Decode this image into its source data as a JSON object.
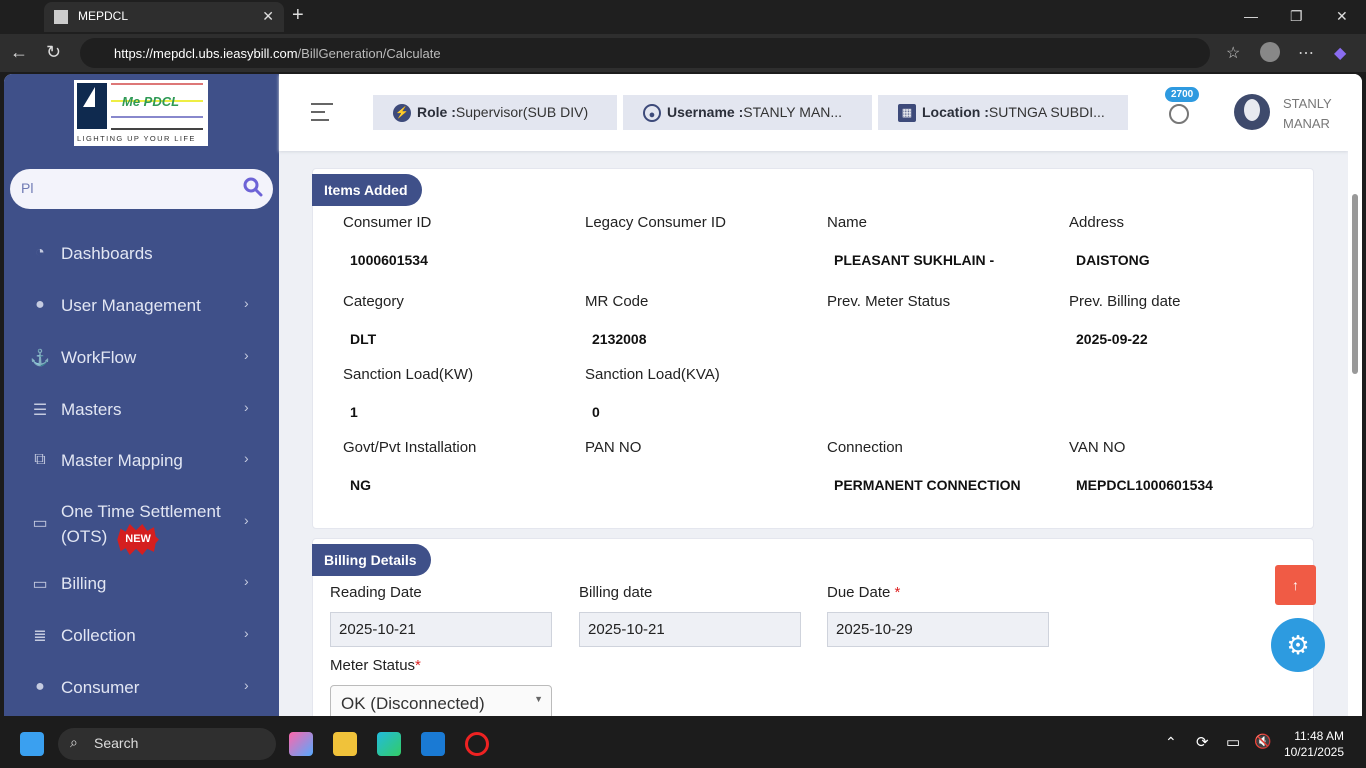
{
  "browser": {
    "tab_title": "MEPDCL",
    "url_host": "https://mepdcl.ubs.ieasybill.com",
    "url_path": "/BillGeneration/Calculate"
  },
  "sidebar": {
    "logo_name": "Me PDCL",
    "logo_tagline": "LIGHTING UP YOUR LIFE",
    "search_value": "Pl",
    "items": [
      {
        "label": "Dashboards",
        "icon": "gauge-icon"
      },
      {
        "label": "User Management",
        "icon": "user-icon"
      },
      {
        "label": "WorkFlow",
        "icon": "anchor-icon"
      },
      {
        "label": "Masters",
        "icon": "server-icon"
      },
      {
        "label": "Master Mapping",
        "icon": "sitemap-icon"
      },
      {
        "label": "One Time Settlement",
        "label2": "(OTS)",
        "badge": "NEW",
        "icon": "desktop-icon"
      },
      {
        "label": "Billing",
        "icon": "desktop-icon"
      },
      {
        "label": "Collection",
        "icon": "list-ol-icon"
      },
      {
        "label": "Consumer",
        "icon": "user-icon"
      }
    ]
  },
  "header": {
    "role_label": "Role :",
    "role_value": "Supervisor(SUB DIV)",
    "username_label": "Username :",
    "username_value": "STANLY MAN...",
    "location_label": "Location :",
    "location_value": "SUTNGA SUBDI...",
    "notification_count": "2700",
    "user_first": "STANLY",
    "user_last": "MANAR"
  },
  "items_added": {
    "title": "Items Added",
    "fields": [
      {
        "label": "Consumer ID",
        "value": "1000601534"
      },
      {
        "label": "Legacy Consumer ID",
        "value": ""
      },
      {
        "label": "Name",
        "value": "PLEASANT SUKHLAIN -"
      },
      {
        "label": "Address",
        "value": "DAISTONG"
      },
      {
        "label": "Category",
        "value": "DLT"
      },
      {
        "label": "MR Code",
        "value": "2132008"
      },
      {
        "label": "Prev. Meter Status",
        "value": ""
      },
      {
        "label": "Prev. Billing date",
        "value": "2025-09-22"
      },
      {
        "label": "Sanction Load(KW)",
        "value": "1"
      },
      {
        "label": "Sanction Load(KVA)",
        "value": "0"
      },
      {
        "label": "Govt/Pvt Installation",
        "value": "NG"
      },
      {
        "label": "PAN NO",
        "value": ""
      },
      {
        "label": "Connection",
        "value": "PERMANENT CONNECTION"
      },
      {
        "label": "VAN NO",
        "value": "MEPDCL1000601534"
      }
    ]
  },
  "billing": {
    "title": "Billing Details",
    "reading_date_label": "Reading Date",
    "reading_date": "2025-10-21",
    "billing_date_label": "Billing date",
    "billing_date": "2025-10-21",
    "due_date_label": "Due Date",
    "due_date": "2025-10-29",
    "required_mark": "*",
    "meter_status_label": "Meter Status",
    "meter_status": "OK (Disconnected)"
  },
  "taskbar": {
    "search": "Search",
    "time": "11:48 AM",
    "date": "10/21/2025"
  }
}
